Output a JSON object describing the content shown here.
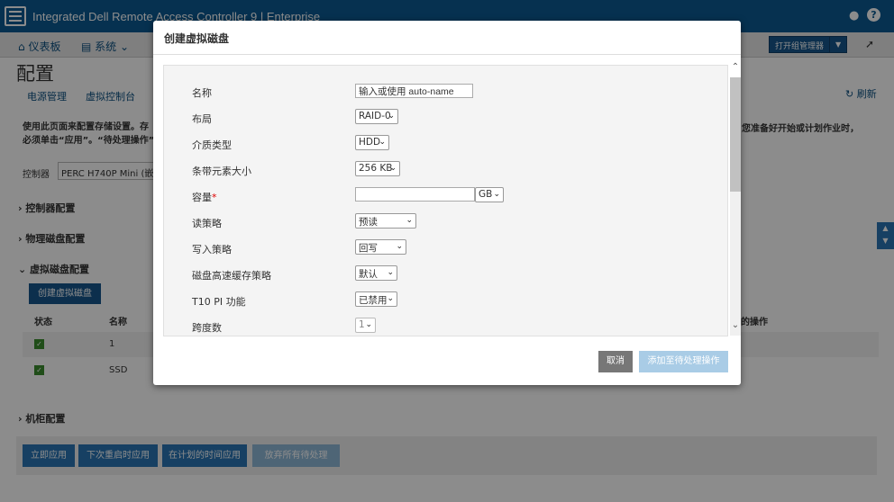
{
  "app": {
    "title": "Integrated Dell Remote Access Controller 9 | Enterprise"
  },
  "nav": {
    "dashboard": "仪表板",
    "system": "系统",
    "open_group_manager": "打开组管理器"
  },
  "page": {
    "title": "配置",
    "tabs": [
      "电源管理",
      "虚拟控制台"
    ],
    "refresh": "刷新",
    "info_line1": "使用此页面来配置存储设置。存",
    "info_line2": "必须单击“应用”。“待处理操作”会",
    "info_right": "您准备好开始或计划作业时，",
    "controller_label": "控制器",
    "controller_value": "PERC H740P Mini (嵌入",
    "sections": {
      "controller_config": "控制器配置",
      "physical_disk_config": "物理磁盘配置",
      "virtual_disk_config": "虚拟磁盘配置",
      "enclosure_config": "机柜配置"
    },
    "create_vd_button": "创建虚拟磁盘",
    "table": {
      "col_status": "状态",
      "col_name": "名称",
      "col_ops": "的操作",
      "rows": [
        {
          "name": "1"
        },
        {
          "name": "SSD"
        }
      ]
    },
    "footer_buttons": [
      "立即应用",
      "下次重启时应用",
      "在计划的时间应用",
      "放弃所有待处理"
    ]
  },
  "modal": {
    "title": "创建虚拟磁盘",
    "fields": {
      "name_label": "名称",
      "name_value": "输入或使用 auto-name",
      "layout_label": "布局",
      "layout_value": "RAID-0",
      "media_label": "介质类型",
      "media_value": "HDD",
      "stripe_label": "条带元素大小",
      "stripe_value": "256 KB",
      "capacity_label": "容量",
      "capacity_value": "",
      "capacity_unit": "GB",
      "read_policy_label": "读策略",
      "read_policy_value": "预读",
      "write_policy_label": "写入策略",
      "write_policy_value": "回写",
      "disk_cache_label": "磁盘高速缓存策略",
      "disk_cache_value": "默认",
      "t10_label": "T10 PI 功能",
      "t10_value": "已禁用",
      "span_label": "跨度数",
      "span_value": "1"
    },
    "required_mark": "*",
    "cancel": "取消",
    "add_pending": "添加至待处理操作"
  },
  "colors": {
    "brand_blue": "#0b5a92",
    "nav_blue": "#16568c",
    "cancel_gray": "#777777",
    "disabled_blue": "#a9cce6"
  }
}
